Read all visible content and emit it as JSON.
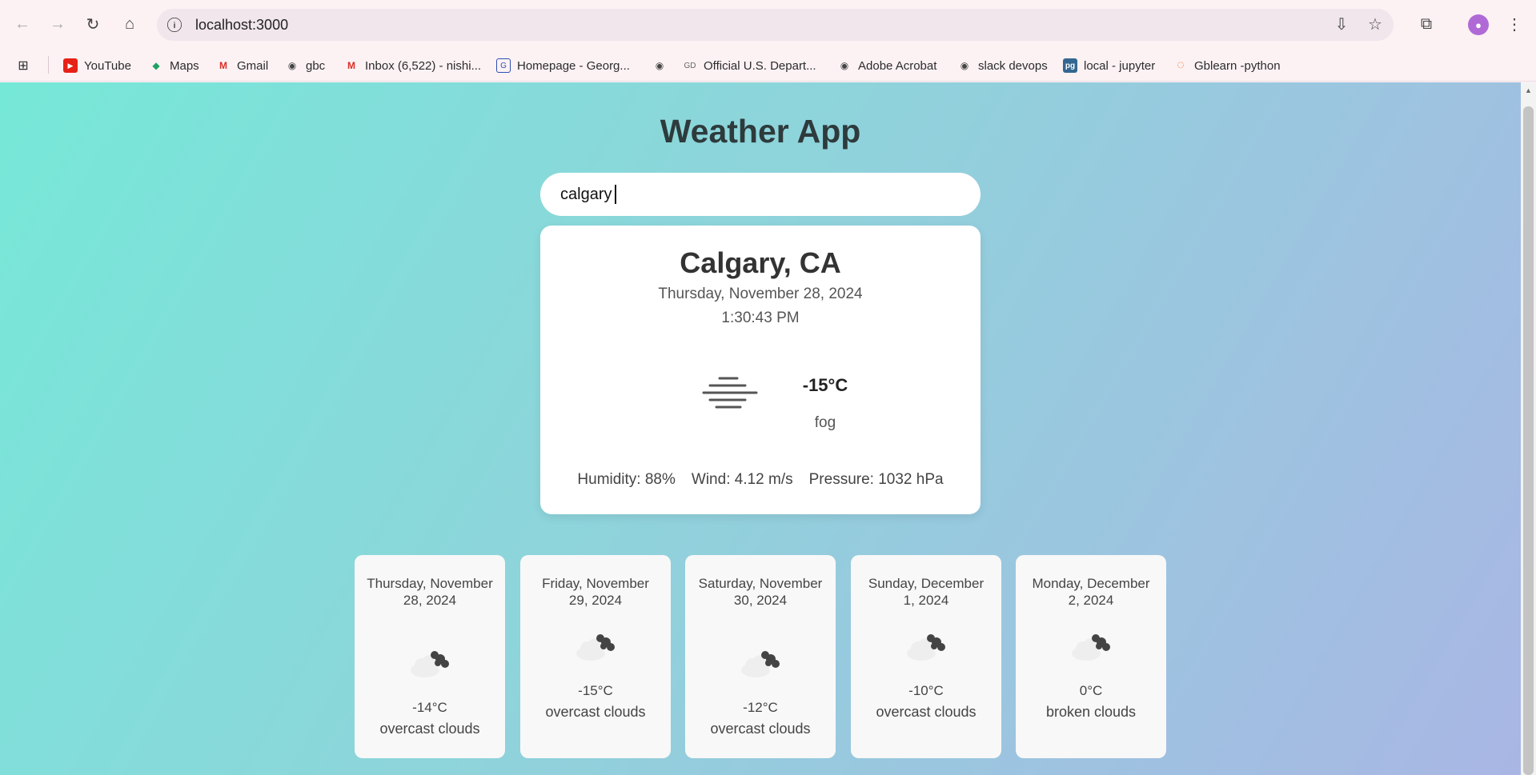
{
  "browser": {
    "url": "localhost:3000",
    "bookmarks": [
      {
        "label": "YouTube",
        "icon": "youtube-icon"
      },
      {
        "label": "Maps",
        "icon": "maps-icon"
      },
      {
        "label": "Gmail",
        "icon": "gmail-icon"
      },
      {
        "label": "gbc",
        "icon": "globe-icon"
      },
      {
        "label": "Inbox (6,522) - nishi...",
        "icon": "gmail-icon"
      },
      {
        "label": "Homepage - Georg...",
        "icon": "college-icon"
      },
      {
        "label": "",
        "icon": "globe-icon"
      },
      {
        "label": "Official U.S. Depart...",
        "icon": "gov-icon"
      },
      {
        "label": "Adobe Acrobat",
        "icon": "globe-icon"
      },
      {
        "label": "slack devops",
        "icon": "globe-icon"
      },
      {
        "label": "local - jupyter",
        "icon": "pg-icon"
      },
      {
        "label": "Gblearn -python",
        "icon": "jupyter-icon"
      }
    ]
  },
  "app": {
    "title": "Weather App",
    "search": {
      "value": "calgary"
    },
    "current": {
      "city": "Calgary, CA",
      "date": "Thursday, November 28, 2024",
      "time": "1:30:43 PM",
      "temp": "-15°C",
      "description": "fog",
      "icon": "fog-icon",
      "humidity": "Humidity: 88%",
      "wind": "Wind: 4.12 m/s",
      "pressure": "Pressure: 1032 hPa"
    },
    "forecast": [
      {
        "date": "Thursday, November 28, 2024",
        "temp": "-14°C",
        "description": "overcast clouds",
        "icon": "overcast-clouds-icon"
      },
      {
        "date": "Friday, November 29, 2024",
        "temp": "-15°C",
        "description": "overcast clouds",
        "icon": "overcast-clouds-icon"
      },
      {
        "date": "Saturday, November 30, 2024",
        "temp": "-12°C",
        "description": "overcast clouds",
        "icon": "overcast-clouds-icon"
      },
      {
        "date": "Sunday, December 1, 2024",
        "temp": "-10°C",
        "description": "overcast clouds",
        "icon": "overcast-clouds-icon"
      },
      {
        "date": "Monday, December 2, 2024",
        "temp": "0°C",
        "description": "broken clouds",
        "icon": "broken-clouds-icon"
      }
    ]
  }
}
